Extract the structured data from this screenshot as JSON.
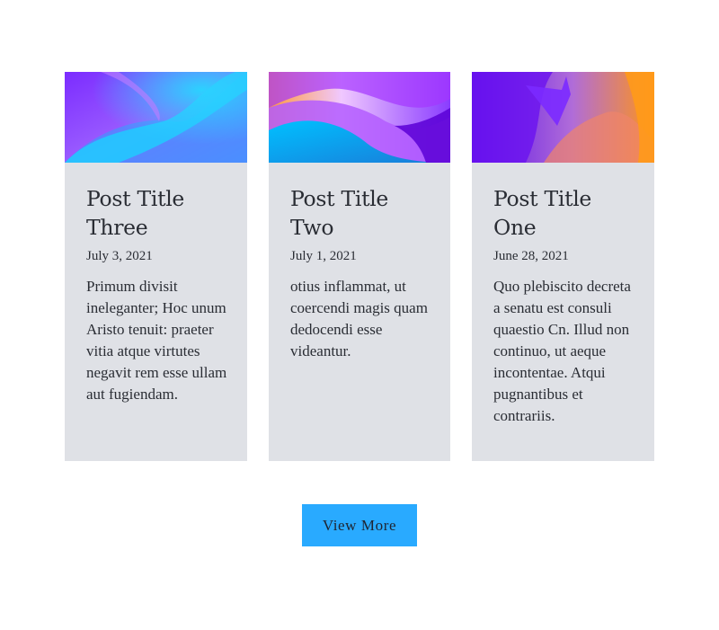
{
  "posts": [
    {
      "title": "Post Title Three",
      "date": "July 3, 2021",
      "excerpt": "Primum divisit ineleganter; Hoc unum Aristo tenuit: praeter vitia atque virtutes negavit rem esse ullam aut fugiendam."
    },
    {
      "title": "Post Title Two",
      "date": "July 1, 2021",
      "excerpt": "otius inflammat, ut coercendi magis quam dedocendi esse videantur."
    },
    {
      "title": "Post Title One",
      "date": "June 28, 2021",
      "excerpt": "Quo plebiscito decreta a senatu est consuli quaestio Cn. Illud non continuo, ut aeque incontentae. Atqui pugnantibus et contrariis."
    }
  ],
  "view_more_label": "View More",
  "colors": {
    "card_bg": "#dfe1e6",
    "button_bg": "#29aaff",
    "text": "#2a2d34"
  }
}
